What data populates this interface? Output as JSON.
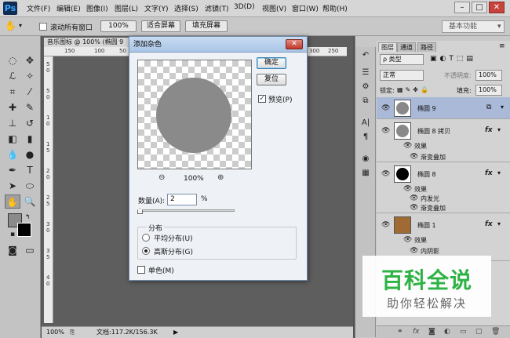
{
  "app": {
    "logo": "Ps"
  },
  "menubar": {
    "items": [
      "文件(F)",
      "编辑(E)",
      "图像(I)",
      "图层(L)",
      "文字(Y)",
      "选择(S)",
      "滤镜(T)",
      "3D(D)",
      "视图(V)",
      "窗口(W)",
      "帮助(H)"
    ]
  },
  "window_controls": {
    "minimize": "–",
    "maximize": "□",
    "close": "✕"
  },
  "options": {
    "scroll_all_windows": "滚动所有窗口",
    "zoom_100": "100%",
    "fit_screen": "适合屏幕",
    "fill_screen": "填充屏幕",
    "workspace": "基本功能"
  },
  "document": {
    "tab_title": "音乐图标 @ 100% (椭圆 9",
    "ruler_h": [
      "150",
      "100",
      "50",
      "300",
      "250"
    ],
    "ruler_v": [
      "5",
      "0",
      "5",
      "0",
      "1",
      "0",
      "1",
      "5",
      "2",
      "0",
      "2",
      "5",
      "3",
      "0",
      "3",
      "5",
      "4",
      "0"
    ],
    "status_zoom": "100%",
    "status_doc": "文档:117.2K/156.3K"
  },
  "dialog": {
    "title": "添加杂色",
    "close": "✕",
    "ok": "确定",
    "reset": "复位",
    "preview_label": "预览(P)",
    "preview_checked": true,
    "zoom_out": "⊖",
    "zoom_level": "100%",
    "zoom_in": "⊕",
    "amount_label": "数量(A):",
    "amount_value": "2",
    "amount_unit": "%",
    "distribution_title": "分布",
    "uniform_label": "平均分布(U)",
    "gaussian_label": "高斯分布(G)",
    "gaussian_selected": true,
    "mono_label": "单色(M)",
    "mono_checked": false
  },
  "panels": {
    "tabs": [
      "图层",
      "通道",
      "路径"
    ],
    "kind_filter": "ρ 类型",
    "blend_mode": "正常",
    "opacity_label": "不透明度:",
    "opacity_value": "100%",
    "lock_label": "锁定:",
    "fill_label": "填充:",
    "fill_value": "100%",
    "layers": [
      {
        "name": "椭圆 9",
        "selected": true,
        "thumb_color": "#888888"
      },
      {
        "name": "椭圆 8 拷贝",
        "selected": false,
        "thumb_color": "#888888",
        "fx": "fx",
        "effects_label": "效果",
        "effects": [
          "渐变叠加"
        ]
      },
      {
        "name": "椭圆 8",
        "selected": false,
        "thumb_color": "#000000",
        "fx": "fx",
        "effects_label": "效果",
        "effects": [
          "内发光",
          "渐变叠加"
        ]
      },
      {
        "name": "椭圆 1",
        "selected": false,
        "thumb_color": "#a06a34",
        "fx": "fx",
        "effects_label": "效果",
        "effects": [
          "内阴影"
        ]
      }
    ]
  },
  "watermark": {
    "title": "百科全说",
    "subtitle": "助你轻松解决"
  }
}
